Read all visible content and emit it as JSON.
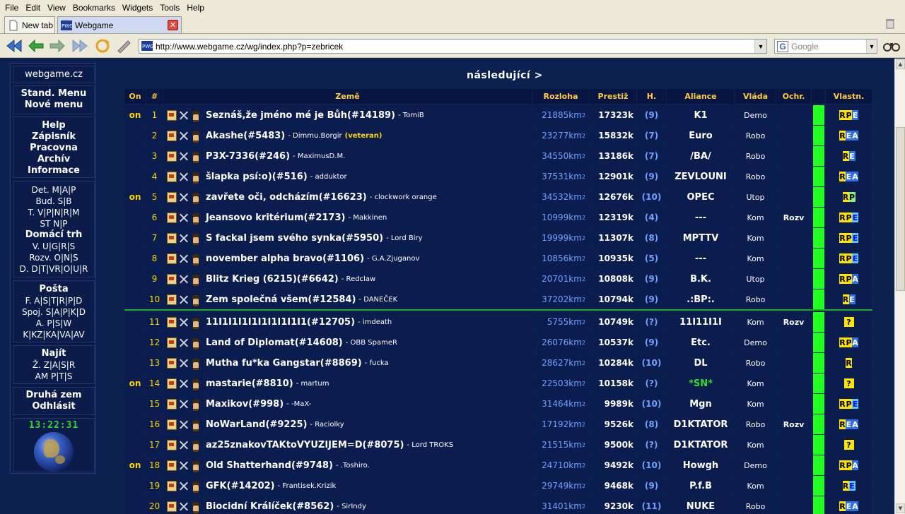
{
  "browser": {
    "menu": [
      "File",
      "Edit",
      "View",
      "Bookmarks",
      "Widgets",
      "Tools",
      "Help"
    ],
    "tabs": [
      {
        "label": "New tab"
      },
      {
        "label": "Webgame"
      }
    ],
    "url": "http://www.webgame.cz/wg/index.php?p=zebricek",
    "search_placeholder": "Google",
    "favicon_text": "PWG"
  },
  "left_menu": {
    "site": "webgame.cz",
    "block1": [
      "Stand. Menu",
      "Nové menu"
    ],
    "block2": [
      "Help",
      "Zápisník",
      "Pracovna",
      "Archív",
      "Informace"
    ],
    "block3": [
      "Det. M|A|P",
      "Bud. S|B",
      "T. V|P|N|R|M",
      "ST N|P",
      "Domácí trh",
      "V. U|G|R|S",
      "Rozv. O|N|S",
      "D. D|T|VR|O|U|R"
    ],
    "block4": [
      "Pošta",
      "F. A|S|T|R|P|D",
      "Spoj. S|A|P|K|D",
      "A. P|S|W",
      "K|KZ|KA|VA|AV"
    ],
    "block5": [
      "Najít",
      "Ž. Z|A|S|R",
      "AM P|T|S"
    ],
    "block6": [
      "Druhá zem",
      "Odhlásit"
    ],
    "clock": "13:22:31"
  },
  "main": {
    "next_link": "následující >",
    "headers": {
      "on": "On",
      "rank": "#",
      "country": "Země",
      "area": "Rozloha",
      "prestige": "Prestiž",
      "h": "H.",
      "alliance": "Aliance",
      "gov": "Vláda",
      "prot": "Ochr.",
      "own": "Vlastn."
    },
    "area_unit": "km",
    "area_exp": "2",
    "colors": {
      "background": "#0d2150",
      "header_text": "#ffcc44",
      "divider": "#1ea81e",
      "bar": "#22ff22"
    },
    "rows": [
      {
        "on": "on",
        "rank": "1",
        "name": "Seznáš,že jméno mé je Bůh(#14189)",
        "player": "- TomiB",
        "vet": "",
        "area": "21885",
        "prestige": "17323k",
        "h": "(9)",
        "alliance": "K1",
        "gov": "Demo",
        "prot": "",
        "own": [
          "RY",
          "PY",
          "EB"
        ]
      },
      {
        "on": "",
        "rank": "2",
        "name": "Akashe(#5483)",
        "player": "- Dimmu.Borgir",
        "vet": "(veteran)",
        "area": "23277km",
        "prestige": "15832k",
        "h": "(7)",
        "alliance": "Euro",
        "gov": "Robo",
        "prot": "",
        "own": [
          "RY",
          "EB",
          "AB"
        ]
      },
      {
        "on": "",
        "rank": "3",
        "name": "P3X-7336(#246)",
        "player": "- MaximusD.M.",
        "vet": "",
        "area": "34550",
        "prestige": "13186k",
        "h": "(7)",
        "alliance": "/BA/",
        "gov": "Robo",
        "prot": "",
        "own": [
          "RY",
          "EB"
        ]
      },
      {
        "on": "",
        "rank": "4",
        "name": "šlapka psí:o)(#516)",
        "player": "- adduktor",
        "vet": "",
        "area": "37531",
        "prestige": "12901k",
        "h": "(9)",
        "alliance": "ZEVLOUNI",
        "gov": "Robo",
        "prot": "",
        "own": [
          "RY",
          "EB",
          "AB"
        ]
      },
      {
        "on": "on",
        "rank": "5",
        "name": "zavřete oči, odcházím(#16623)",
        "player": "- clockwork orange",
        "vet": "",
        "area": "34532",
        "prestige": "12676k",
        "h": "(10)",
        "alliance": "OPEC",
        "gov": "Utop",
        "prot": "",
        "own": [
          "RY",
          "PG"
        ]
      },
      {
        "on": "",
        "rank": "6",
        "name": "Jeansovo kritérium(#2173)",
        "player": "- Makkinen",
        "vet": "",
        "area": "10999",
        "prestige": "12319k",
        "h": "(4)",
        "alliance": "---",
        "gov": "Kom",
        "prot": "Rozv",
        "own": [
          "RY",
          "PY",
          "EL"
        ]
      },
      {
        "on": "",
        "rank": "7",
        "name": "S fackal jsem svého synka(#5950)",
        "player": "- Lord Biry",
        "vet": "",
        "area": "19999",
        "prestige": "11307k",
        "h": "(8)",
        "alliance": "MPTTV",
        "gov": "Kom",
        "prot": "",
        "own": [
          "RY",
          "PY",
          "EL"
        ]
      },
      {
        "on": "",
        "rank": "8",
        "name": "november alpha bravo(#1106)",
        "player": "- G.A.Zjuganov",
        "vet": "",
        "area": "10856",
        "prestige": "10935k",
        "h": "(5)",
        "alliance": "---",
        "gov": "Kom",
        "prot": "",
        "own": [
          "RY",
          "PY",
          "EL"
        ]
      },
      {
        "on": "",
        "rank": "9",
        "name": "Blitz Krieg (6215)(#6642)",
        "player": "- Redclaw",
        "vet": "",
        "area": "20701",
        "prestige": "10808k",
        "h": "(9)",
        "alliance": "B.K.",
        "gov": "Utop",
        "prot": "",
        "own": [
          "RY",
          "PY",
          "AB"
        ]
      },
      {
        "on": "",
        "rank": "10",
        "name": "Zem společná všem(#12584)",
        "player": "- DANEČEK",
        "vet": "",
        "area": "37202",
        "prestige": "10794k",
        "h": "(9)",
        "alliance": ".:BP:.",
        "gov": "Robo",
        "prot": "",
        "own": [
          "RY",
          "EB"
        ]
      },
      {
        "on": "",
        "rank": "11",
        "name": "11I1I1I1I1I1I1I1I1I1(#12705)",
        "player": "- imdeath",
        "vet": "",
        "area": "5755",
        "prestige": "10749k",
        "h": "(?)",
        "alliance": "11I11I1I",
        "gov": "Kom",
        "prot": "Rozv",
        "own": [
          "?"
        ]
      },
      {
        "on": "",
        "rank": "12",
        "name": "Land of Diplomat(#14608)",
        "player": "- OBB SpameR",
        "vet": "",
        "area": "26076",
        "prestige": "10537k",
        "h": "(9)",
        "alliance": "Etc.",
        "gov": "Demo",
        "prot": "",
        "own": [
          "RY",
          "PY",
          "AB"
        ]
      },
      {
        "on": "",
        "rank": "13",
        "name": "Mutha fu*ka Gangstar(#8869)",
        "player": "- fucka",
        "vet": "",
        "area": "28627",
        "prestige": "10284k",
        "h": "(10)",
        "alliance": "DL",
        "gov": "Robo",
        "prot": "",
        "own": [
          "RY"
        ]
      },
      {
        "on": "on",
        "rank": "14",
        "name": "mastarie(#8810)",
        "player": "- martum",
        "vet": "",
        "area": "22503",
        "prestige": "10158k",
        "h": "(?)",
        "alliance": "*SN*",
        "gov": "Kom",
        "prot": "",
        "own": [
          "?"
        ]
      },
      {
        "on": "",
        "rank": "15",
        "name": "Maxikov(#998)",
        "player": "- -MaX-",
        "vet": "",
        "area": "31464",
        "prestige": "9989k",
        "h": "(10)",
        "alliance": "Mgn",
        "gov": "Kom",
        "prot": "",
        "own": [
          "RY",
          "PY",
          "EL"
        ]
      },
      {
        "on": "",
        "rank": "16",
        "name": "NoWarLand(#9225)",
        "player": "- Raciolky",
        "vet": "",
        "area": "17192",
        "prestige": "9526k",
        "h": "(8)",
        "alliance": "D1KTATOR",
        "gov": "Robo",
        "prot": "Rozv",
        "own": [
          "RY",
          "EB",
          "AB"
        ]
      },
      {
        "on": "",
        "rank": "17",
        "name": "az25znakovTAKtoVYUZIJEM=D(#8075)",
        "player": "- Lord TROKS",
        "vet": "",
        "area": "21515",
        "prestige": "9500k",
        "h": "(?)",
        "alliance": "D1KTATOR",
        "gov": "Kom",
        "prot": "",
        "own": [
          "?"
        ]
      },
      {
        "on": "on",
        "rank": "18",
        "name": "Old Shatterhand(#9748)",
        "player": "- .Toshiro.",
        "vet": "",
        "area": "24710",
        "prestige": "9492k",
        "h": "(10)",
        "alliance": "Howgh",
        "gov": "Demo",
        "prot": "",
        "own": [
          "RY",
          "PY",
          "AB"
        ]
      },
      {
        "on": "",
        "rank": "19",
        "name": "GFK(#14202)",
        "player": "- Frantisek.Krizik",
        "vet": "",
        "area": "29749",
        "prestige": "9468k",
        "h": "(9)",
        "alliance": "P.f.B",
        "gov": "Kom",
        "prot": "",
        "own": [
          "RY",
          "EL"
        ]
      },
      {
        "on": "",
        "rank": "20",
        "name": "Biocidní Králíček(#8562)",
        "player": "- SirIndy",
        "vet": "",
        "area": "31401",
        "prestige": "9230k",
        "h": "(11)",
        "alliance": "NUKE",
        "gov": "Robo",
        "prot": "",
        "own": [
          "RY",
          "EB",
          "AB"
        ]
      }
    ]
  }
}
